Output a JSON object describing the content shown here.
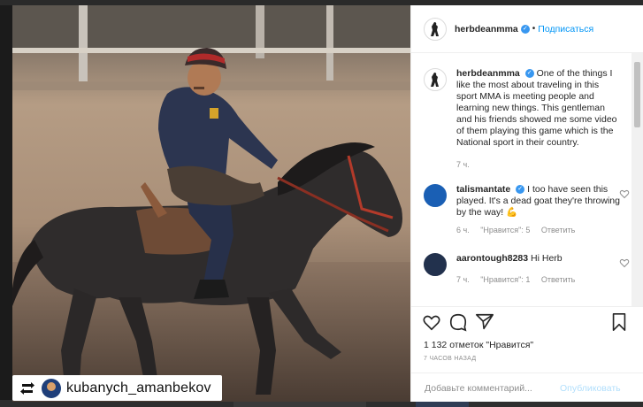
{
  "repost": {
    "username": "kubanych_amanbekov"
  },
  "header": {
    "username": "herbdeanmma",
    "follow_label": "Подписаться",
    "separator": "•"
  },
  "caption": {
    "username": "herbdeanmma",
    "text": "One of the things I like the most about traveling in this sport MMA is meeting people and learning new things. This gentleman and his friends showed me some video of them playing this game which is the National sport in their country.",
    "time": "7 ч."
  },
  "comments": [
    {
      "username": "talismantate",
      "verified": true,
      "text": "I too have seen this played. It's a dead goat they're throwing by the way! 💪",
      "time": "6 ч.",
      "likes": "\"Нравится\": 5",
      "reply": "Ответить"
    },
    {
      "username": "aarontough8283",
      "verified": false,
      "text": "Hi Herb",
      "time": "7 ч.",
      "likes": "\"Нравится\": 1",
      "reply": "Ответить"
    }
  ],
  "likes_text": "1 132 отметок \"Нравится\"",
  "timestamp": "7 ЧАСОВ НАЗАД",
  "comment_box": {
    "placeholder": "Добавьте комментарий...",
    "publish_label": "Опубликовать"
  },
  "colors": {
    "accent": "#0095f6",
    "verified": "#3897f0",
    "muted": "#8e8e8e"
  },
  "icons": [
    "repost-icon",
    "heart-icon",
    "comment-icon",
    "share-icon",
    "bookmark-icon",
    "verified-icon"
  ]
}
